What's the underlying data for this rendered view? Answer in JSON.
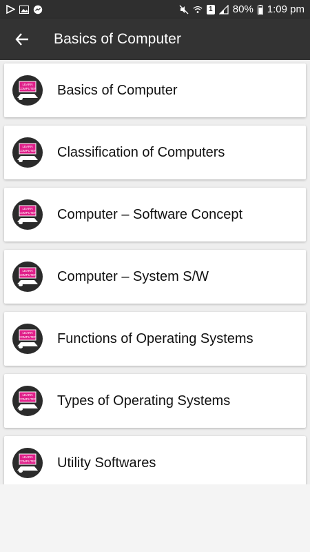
{
  "status_bar": {
    "battery": "80%",
    "time": "1:09 pm",
    "sim_badge": "1"
  },
  "app_bar": {
    "title": "Basics of Computer"
  },
  "icon_text": {
    "line1": "LEARN",
    "line2": "COMPUTER"
  },
  "items": [
    {
      "label": "Basics of Computer"
    },
    {
      "label": "Classification of Computers"
    },
    {
      "label": "Computer – Software Concept"
    },
    {
      "label": "Computer – System S/W"
    },
    {
      "label": "Functions of Operating Systems"
    },
    {
      "label": "Types of Operating Systems"
    },
    {
      "label": "Utility Softwares"
    }
  ],
  "colors": {
    "app_bar": "#333333",
    "status_bar": "#2f2f2f",
    "icon_screen": "#e0208a"
  }
}
